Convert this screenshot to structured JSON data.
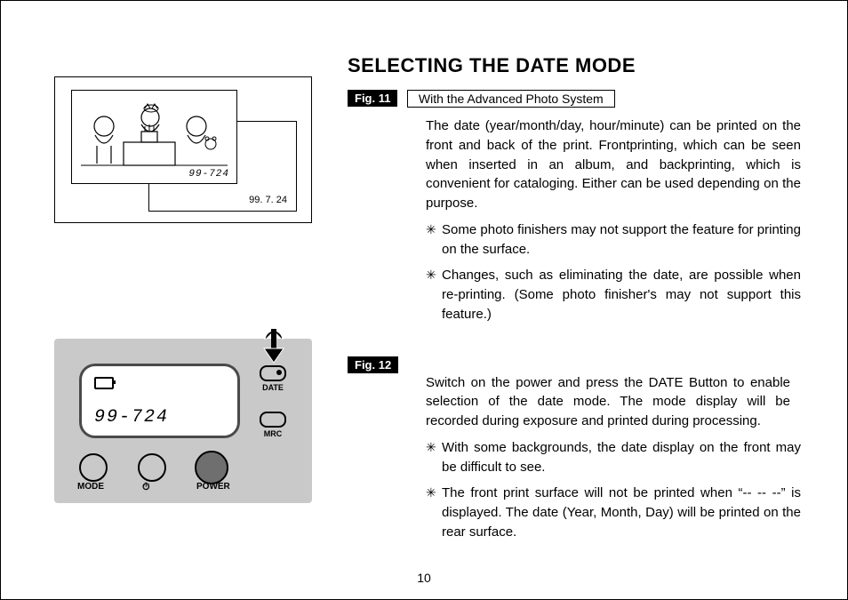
{
  "title": "SELECTING THE DATE MODE",
  "page_number": "10",
  "section1": {
    "fig_label": "Fig. 11",
    "sub_box": "With the Advanced Photo System",
    "para": "The date (year/month/day, hour/minute) can be printed on the front and back of the print. Frontprinting, which can be seen when inserted in an album, and backprinting, which is convenient for cataloging.  Either can be used depending on the purpose.",
    "note1": "Some photo finishers may not support the feature for printing on the surface.",
    "note2": "Changes, such as eliminating the date, are possible when re-printing. (Some photo finisher's may not support this feature.)"
  },
  "section2": {
    "fig_label": "Fig. 12",
    "para": "Switch on the power and press the DATE Button to enable selection of the date mode. The mode display will be recorded during exposure and printed during processing.",
    "note1": "With some backgrounds, the date display on the front may be difficult to see.",
    "note2": "The front print surface will not be printed when “--  --  --” is displayed. The date (Year, Month, Day) will be printed on the rear surface."
  },
  "fig11": {
    "front_date": "99-724",
    "back_date": "99. 7. 24"
  },
  "fig12": {
    "lcd_date": "99-724",
    "labels": {
      "mode": "MODE",
      "timer": "⏱",
      "power": "POWER",
      "date": "DATE",
      "mrc": "MRC"
    }
  }
}
